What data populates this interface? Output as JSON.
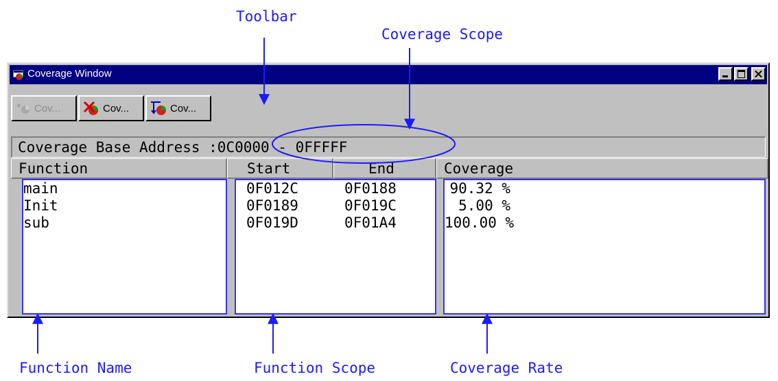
{
  "annotations": {
    "toolbar": "Toolbar",
    "coverage_scope": "Coverage Scope",
    "function_name": "Function Name",
    "function_scope": "Function Scope",
    "coverage_rate": "Coverage Rate"
  },
  "window": {
    "title": "Coverage Window",
    "icon": "coverage-app-icon",
    "controls": [
      "minimize-icon",
      "maximize-icon",
      "close-icon"
    ]
  },
  "toolbar": {
    "buttons": [
      {
        "label": "Cov...",
        "icon": "coverage-add-icon",
        "enabled": false
      },
      {
        "label": "Cov...",
        "icon": "coverage-clear-icon",
        "enabled": true
      },
      {
        "label": "Cov...",
        "icon": "coverage-set-icon",
        "enabled": true
      }
    ]
  },
  "base_address": {
    "label": "Coverage Base Address :",
    "range": "0C0000 - 0FFFFF"
  },
  "columns": {
    "function": "Function",
    "start": "Start",
    "end": "End",
    "coverage": "Coverage"
  },
  "rows": [
    {
      "function": "main",
      "start": "0F012C",
      "end": "0F0188",
      "coverage": "90.32 %"
    },
    {
      "function": "Init",
      "start": "0F0189",
      "end": "0F019C",
      "coverage": "5.00 %"
    },
    {
      "function": "sub",
      "start": "0F019D",
      "end": "0F01A4",
      "coverage": "100.00 %"
    }
  ],
  "colors": {
    "annotation": "#1a1aff",
    "titlebar": "#000080",
    "window_face": "#c0c0c0"
  }
}
